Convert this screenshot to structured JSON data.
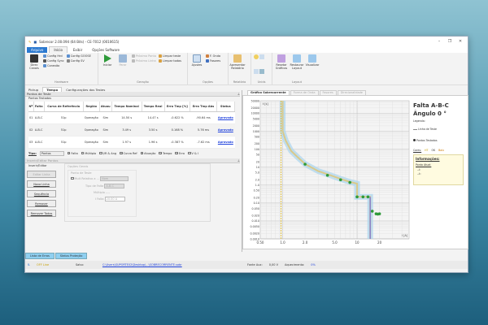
{
  "window": {
    "title": "Sobrecor 2.00.094 (64 Bits) - CE-7012 (0010615)",
    "min": "–",
    "max": "❐",
    "close": "✕"
  },
  "menu_tabs": [
    "Arquivo",
    "Início",
    "Exibir",
    "Opções Software"
  ],
  "ribbon": {
    "hardware": {
      "label": "Hardware",
      "direc": "Direc Canais",
      "items": [
        "Config Hrd",
        "Config Sync",
        "Conexão",
        "Config GOOSE",
        "Config SV"
      ]
    },
    "geracao": {
      "label": "Geração",
      "iniciar": "Iniciar",
      "parar": "Parar",
      "items": [
        "Próximo Ponto",
        "Próxima Linha",
        "Limpar teste",
        "Limpar todos"
      ]
    },
    "opcoes": {
      "label": "Opções",
      "ajustes": "Ajustes",
      "items": [
        "F. Onda",
        "Fasores"
      ]
    },
    "relatorio": {
      "label": "Relatório",
      "apresentar": "Apresentar Relatório"
    },
    "unids": {
      "label": "Unids"
    },
    "layout": {
      "label": "Layout",
      "items": [
        "Resetar Gráficos",
        "Restaurar Layout",
        "Visualizar"
      ]
    }
  },
  "left": {
    "tabs": [
      "Pickup",
      "Tempo",
      "Configurações dos Testes"
    ],
    "active_tab": "Tempo",
    "panel_title": "Pontos de Teste",
    "sub_title": "Pontos Testados",
    "columns": [
      "Nº",
      "Falta",
      "Curva de Referência",
      "Região",
      "Atuou",
      "Tempo Nominal",
      "Tempo Real",
      "Erro Tmp [%]",
      "Erro Tmp Abs",
      "Status"
    ],
    "rows": [
      [
        "01",
        "A-B-C",
        "51p",
        "Operação",
        "Sim",
        "14.50 s",
        "14.47 s",
        "-0.622 %",
        "-90.64 ms",
        "Aprovado"
      ],
      [
        "02",
        "A-B-C",
        "51p",
        "Operação",
        "Sim",
        "3.49 s",
        "3.50 s",
        "0.168 %",
        "5.76 ms",
        "Aprovado"
      ],
      [
        "03",
        "A-B-C",
        "51p",
        "Operação",
        "Sim",
        "1.97 s",
        "1.96 s",
        "-0.387 %",
        "-7.62 ms",
        "Aprovado"
      ]
    ],
    "filters": {
      "tipo_label": "Tipo:",
      "tipo_value": "Pontos",
      "checks": [
        {
          "label": "Falta",
          "on": true
        },
        {
          "label": "Múltiplo",
          "on": false
        },
        {
          "label": "I/R & Ang",
          "on": false
        },
        {
          "label": "Curva Ref",
          "on": true
        },
        {
          "label": "Atuação",
          "on": true
        },
        {
          "label": "Tempo",
          "on": true
        },
        {
          "label": "Erro",
          "on": true
        },
        {
          "label": "V & I",
          "on": false
        }
      ]
    },
    "editor": {
      "title": "Inserir/Editar Pontos",
      "group": "Inserir/Editar",
      "buttons": [
        "Editar Linha",
        "Nova Linha",
        "Sequência",
        "Remover",
        "Remover Todos"
      ],
      "options_title": "Opções Gerais",
      "point_title": "Ponto de Teste",
      "mult_label": "Mult Relativo a ...",
      "mult_value": "Nom",
      "tipo_falta_label": "Tipo de Falta",
      "tipo_falta_value": "A-B-C",
      "multiplo_label": "Múltiplo",
      "multiplo_value": "----",
      "ifalta_label": "I Falta",
      "ifalta_value": "20.00 A"
    }
  },
  "right": {
    "tabs": [
      "Gráfico Sobrecorrente",
      "Forma de Onda",
      "Fasores",
      "Direcionalidade"
    ],
    "fault": "Falta A-B-C",
    "angle": "Ângulo 0 °",
    "legend_title": "Legenda:",
    "legend_line": "Linha de Teste",
    "legend_points": "Pontos Testados",
    "cores_label": "Cores:",
    "cores": [
      {
        "t": "HT",
        "c": "#c8a000"
      },
      {
        "t": "OK",
        "c": "#333333"
      },
      {
        "t": "Baix",
        "c": "#cc7700"
      }
    ],
    "info_title": "Informações:",
    "ponto_atual": "Ponto Atual:",
    "info_lines": [
      "--I:",
      "--t:"
    ]
  },
  "chart_data": {
    "type": "line",
    "xscale": "log",
    "yscale": "log",
    "xlim": [
      0.5,
      50
    ],
    "ylim": [
      0.001,
      50000
    ],
    "grid": true,
    "xunit": "I [A]",
    "yunit": "t [s]",
    "xticks": [
      "0.50",
      "1.0",
      "2.0",
      "5.0",
      "10",
      "20"
    ],
    "xtick_values": [
      0.5,
      1,
      2,
      5,
      10,
      20
    ],
    "yticks": [
      "50000",
      "20000",
      "10000",
      "5000",
      "2000",
      "1000",
      "500",
      "200",
      "100",
      "50",
      "20",
      "10",
      "5.0",
      "2.0",
      "1.0",
      "0.50",
      "0.20",
      "0.10",
      "0.050",
      "0.020",
      "0.010",
      "0.0050",
      "0.0020",
      "0.0010"
    ],
    "ytick_values": [
      50000,
      20000,
      10000,
      5000,
      2000,
      1000,
      500,
      200,
      100,
      50,
      20,
      10,
      5,
      2,
      1,
      0.5,
      0.2,
      0.1,
      0.05,
      0.02,
      0.01,
      0.005,
      0.002,
      0.001
    ],
    "pickup_x": 0.95,
    "curve": [
      [
        1,
        50000
      ],
      [
        1,
        1000
      ],
      [
        1.1,
        300
      ],
      [
        1.3,
        80
      ],
      [
        1.6,
        35
      ],
      [
        2,
        15
      ],
      [
        3,
        6
      ],
      [
        4,
        4
      ],
      [
        6,
        2.2
      ],
      [
        8,
        1.5
      ],
      [
        10,
        1.2
      ],
      [
        10,
        0.22
      ],
      [
        15,
        0.22
      ],
      [
        15,
        0.001
      ]
    ],
    "points": [
      [
        2,
        14.5
      ],
      [
        4,
        3.5
      ],
      [
        6,
        1.97
      ],
      [
        8,
        1.4
      ],
      [
        10,
        0.22
      ],
      [
        12,
        0.22
      ],
      [
        14,
        0.22
      ],
      [
        16,
        0.035
      ],
      [
        18,
        0.025
      ],
      [
        19,
        0.024
      ],
      [
        20,
        0.025
      ]
    ],
    "colors": {
      "curve": "#d9c98a",
      "band": "#a9d4ee",
      "pickup": "#e0c040",
      "step": "#7070e0",
      "point": "#2e9a3a"
    }
  },
  "bottom_tabs": [
    "Lista de Erros",
    "Status Proteção"
  ],
  "status": {
    "mode": "OFF Line",
    "saved": "Salvo",
    "path": "C:\\Users\\SUPORTE02\\Desktop\\...\\SOBRECORRENTE.sobr",
    "fonte_label": "Fonte Aux:",
    "fonte_value": "0,00 V",
    "aquec_label": "Aquecimento:",
    "aquec_value": "0%"
  }
}
